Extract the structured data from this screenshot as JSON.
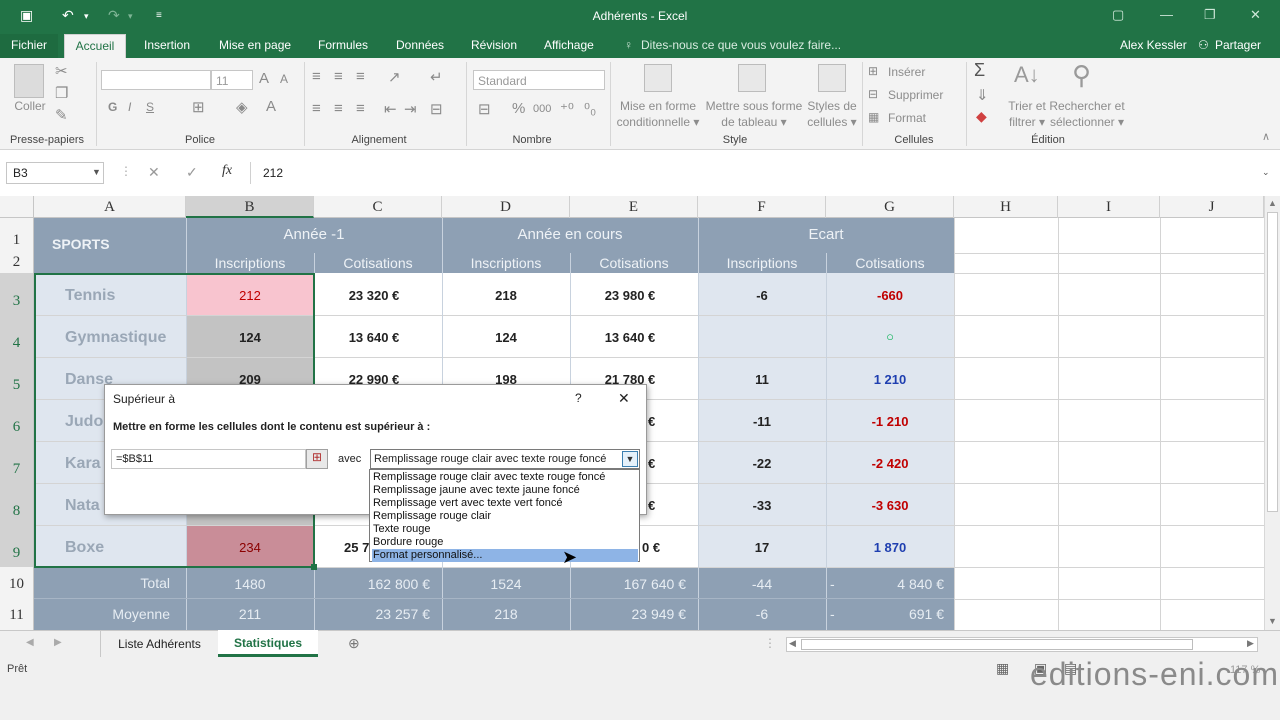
{
  "window": {
    "title": "Adhérents - Excel",
    "user": "Alex Kessler",
    "share": "Partager",
    "tell_me": "Dites-nous ce que vous voulez faire..."
  },
  "tabs": [
    "Fichier",
    "Accueil",
    "Insertion",
    "Mise en page",
    "Formules",
    "Données",
    "Révision",
    "Affichage"
  ],
  "ribbon": {
    "paste": "Coller",
    "clipboard": "Presse-papiers",
    "font_size": "11",
    "police": "Police",
    "bold": "G",
    "italic": "I",
    "underline": "S",
    "alignment": "Alignement",
    "number_format": "Standard",
    "nombre": "Nombre",
    "percent": "%",
    "thousands": "000",
    "cond_format_1": "Mise en forme",
    "cond_format_2": "conditionnelle",
    "table_1": "Mettre sous forme",
    "table_2": "de tableau",
    "styles_1": "Styles de",
    "styles_2": "cellules",
    "style": "Style",
    "insert": "Insérer",
    "delete": "Supprimer",
    "format": "Format",
    "cells": "Cellules",
    "sort_1": "Trier et",
    "sort_2": "filtrer",
    "find_1": "Rechercher et",
    "find_2": "sélectionner",
    "edition": "Édition"
  },
  "formula_bar": {
    "name_box": "B3",
    "fx": "fx",
    "value": "212"
  },
  "columns": [
    "A",
    "B",
    "C",
    "D",
    "E",
    "F",
    "G",
    "H",
    "I",
    "J"
  ],
  "rows": [
    "1",
    "2",
    "3",
    "4",
    "5",
    "6",
    "7",
    "8",
    "9",
    "10",
    "11"
  ],
  "headers": {
    "sports": "SPORTS",
    "year_prev": "Année -1",
    "year_cur": "Année en cours",
    "ecart": "Ecart",
    "inscriptions": "Inscriptions",
    "cotisations": "Cotisations"
  },
  "data_rows": [
    {
      "sport": "Tennis",
      "b": "212",
      "c": "23 320 €",
      "d": "218",
      "e": "23 980 €",
      "f": "-6",
      "g": "-660"
    },
    {
      "sport": "Gymnastique",
      "b": "124",
      "c": "13 640 €",
      "d": "124",
      "e": "13 640 €",
      "f": "",
      "g": "○"
    },
    {
      "sport": "Danse",
      "b": "209",
      "c": "22 990 €",
      "d": "198",
      "e": "21 780 €",
      "f": "11",
      "g": "1 210"
    },
    {
      "sport": "Judo",
      "b": "",
      "c": "",
      "d": "",
      "e": "€",
      "f": "-11",
      "g": "-1 210"
    },
    {
      "sport": "Kara",
      "b": "",
      "c": "",
      "d": "",
      "e": "€",
      "f": "-22",
      "g": "-2 420"
    },
    {
      "sport": "Nata",
      "b": "",
      "c": "",
      "d": "",
      "e": "€",
      "f": "-33",
      "g": "-3 630"
    },
    {
      "sport": "Boxe",
      "b": "234",
      "c": "25 7",
      "d": "",
      "e": "0 €",
      "f": "17",
      "g": "1 870"
    }
  ],
  "totals": [
    {
      "label": "Total",
      "b": "1480",
      "c": "162 800 €",
      "d": "1524",
      "e": "167 640 €",
      "f": "-44",
      "dash": "-",
      "g": "4 840 €"
    },
    {
      "label": "Moyenne",
      "b": "211",
      "c": "23 257 €",
      "d": "218",
      "e": "23 949 €",
      "f": "-6",
      "dash": "-",
      "g": "691 €"
    }
  ],
  "dialog": {
    "title": "Supérieur à",
    "help": "?",
    "close": "✕",
    "instruction": "Mettre en forme les cellules dont le contenu est supérieur à :",
    "value": "=$B$11",
    "with": "avec",
    "selected": "Remplissage rouge clair avec texte rouge foncé",
    "options": [
      "Remplissage rouge clair avec texte rouge foncé",
      "Remplissage jaune avec texte jaune foncé",
      "Remplissage vert avec texte vert foncé",
      "Remplissage rouge clair",
      "Texte rouge",
      "Bordure rouge",
      "Format personnalisé..."
    ]
  },
  "sheets": [
    "Liste Adhérents",
    "Statistiques"
  ],
  "status": {
    "ready": "Prêt",
    "zoom": "117 %"
  },
  "watermark": "editions-eni.com",
  "colors": {
    "excel_green": "#217346",
    "header_blue": "#8ea0b4",
    "total_blue": "#8ea0b4",
    "light_blue": "#dfe6ef",
    "pink": "#f8c4cf",
    "dark_pink": "#c98d98",
    "gray": "#c3c3c3",
    "red": "#c00000",
    "blue": "#1f3fb0",
    "green": "#00b050"
  }
}
